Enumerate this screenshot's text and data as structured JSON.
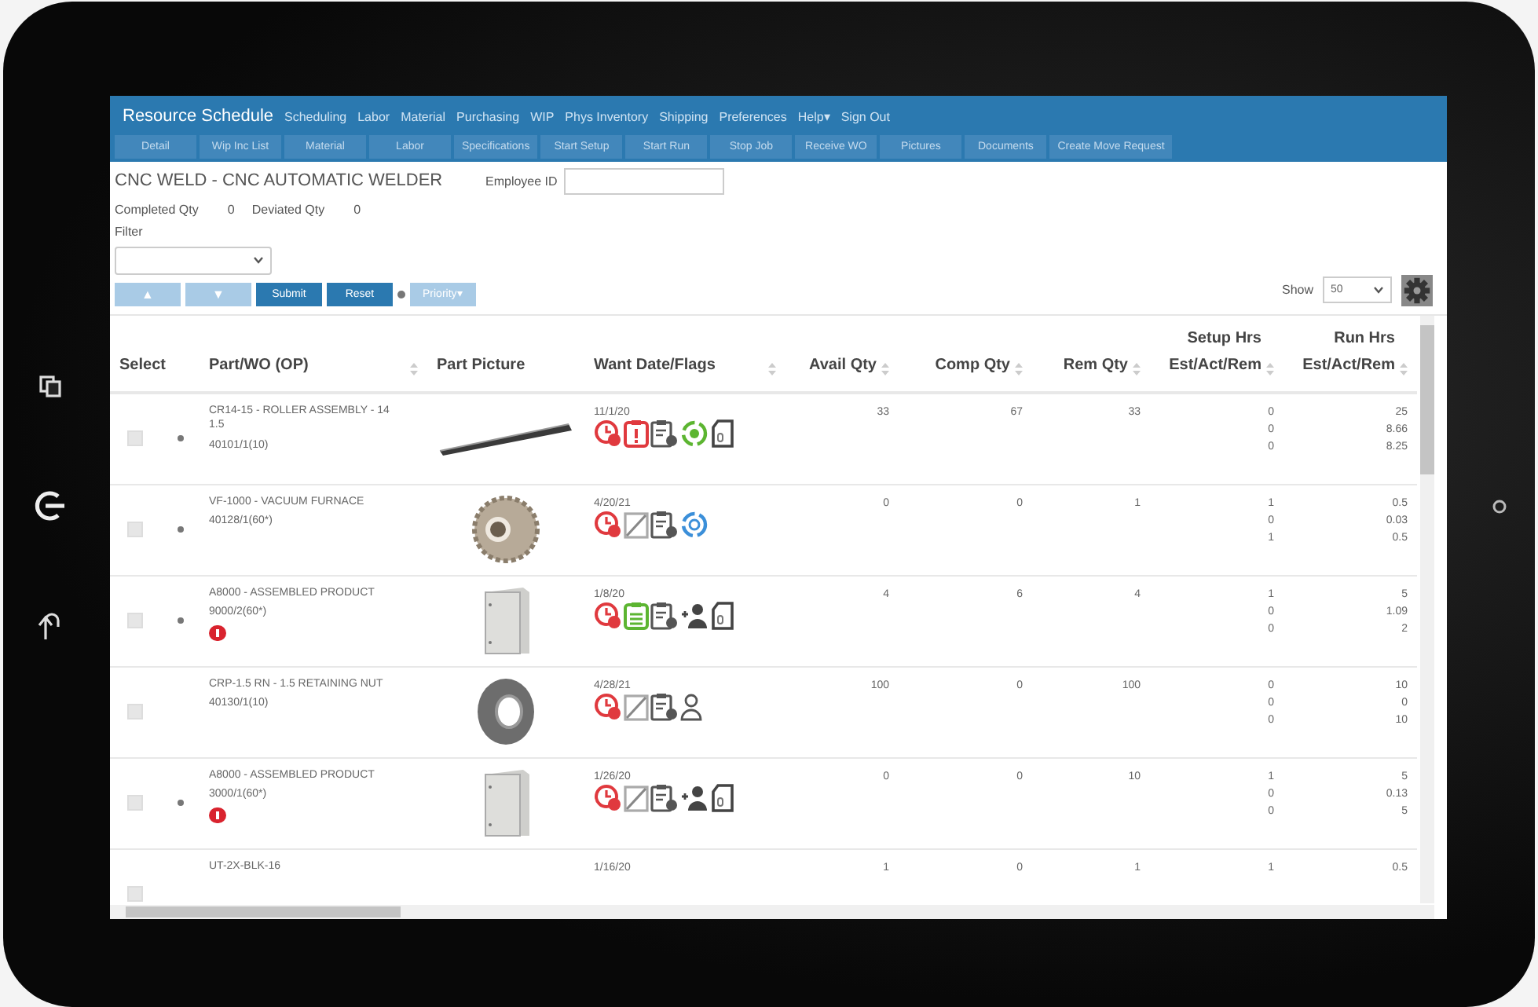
{
  "nav": {
    "brand": "Resource Schedule",
    "items": [
      {
        "label": "Scheduling"
      },
      {
        "label": "Labor"
      },
      {
        "label": "Material"
      },
      {
        "label": "Purchasing"
      },
      {
        "label": "WIP"
      },
      {
        "label": "Phys Inventory"
      },
      {
        "label": "Shipping"
      },
      {
        "label": "Preferences"
      },
      {
        "label": "Help",
        "caret": "▾"
      },
      {
        "label": "Sign Out"
      }
    ]
  },
  "toolbar": [
    {
      "label": "Detail",
      "disabled": true
    },
    {
      "label": "Wip Inc List",
      "disabled": true
    },
    {
      "label": "Material",
      "disabled": true
    },
    {
      "label": "Labor",
      "disabled": true
    },
    {
      "label": "Specifications",
      "disabled": true
    },
    {
      "label": "Start Setup",
      "disabled": true
    },
    {
      "label": "Start Run",
      "disabled": true
    },
    {
      "label": "Stop Job",
      "disabled": true
    },
    {
      "label": "Receive WO",
      "disabled": true
    },
    {
      "label": "Pictures",
      "disabled": true
    },
    {
      "label": "Documents",
      "disabled": true
    },
    {
      "label": "Create Move Request",
      "disabled": true
    }
  ],
  "header": {
    "title": "CNC WELD - CNC AUTOMATIC WELDER",
    "employee_label": "Employee ID",
    "completed_label": "Completed Qty",
    "completed_value": "0",
    "deviated_label": "Deviated Qty",
    "deviated_value": "0",
    "filter_label": "Filter"
  },
  "controls": {
    "up": "▲",
    "down": "▼",
    "submit": "Submit",
    "reset": "Reset",
    "priority": "Priority▾",
    "show_label": "Show",
    "show_value": "50"
  },
  "table": {
    "columns": [
      {
        "title": "Select",
        "sortable": false
      },
      {
        "title": "Part/WO (OP)",
        "sortable": true
      },
      {
        "title": "Part Picture",
        "sortable": false
      },
      {
        "title": "Want Date/Flags",
        "sortable": true
      },
      {
        "title": "Avail Qty",
        "sortable": true
      },
      {
        "title": "Comp Qty",
        "sortable": true
      },
      {
        "title": "Rem Qty",
        "sortable": true
      },
      {
        "title": "Setup Hrs",
        "sub": "Est/Act/Rem",
        "sortable": true
      },
      {
        "title": "Run Hrs",
        "sub": "Est/Act/Rem",
        "sortable": true
      }
    ],
    "rows": [
      {
        "checked": false,
        "bullet": true,
        "part": "CR14-15 - ROLLER ASSEMBLY - 14 1.5",
        "wo": "40101/1(10)",
        "alert": false,
        "picture": {
          "kind": "roller"
        },
        "date": "11/1/20",
        "flags": [
          {
            "kind": "clock"
          },
          {
            "kind": "alert-doc"
          },
          {
            "kind": "note"
          },
          {
            "kind": "cycle-green"
          },
          {
            "kind": "attach"
          }
        ],
        "avail": "33",
        "comp": "67",
        "rem": "33",
        "setup": [
          "0",
          "0",
          "0"
        ],
        "run": [
          "25",
          "8.66",
          "8.25"
        ]
      },
      {
        "checked": false,
        "bullet": true,
        "part": "VF-1000 - VACUUM FURNACE",
        "wo": "40128/1(60*)",
        "alert": false,
        "picture": {
          "kind": "gear"
        },
        "date": "4/20/21",
        "flags": [
          {
            "kind": "clock"
          },
          {
            "kind": "edit"
          },
          {
            "kind": "note"
          },
          {
            "kind": "cycle-blue"
          }
        ],
        "avail": "0",
        "comp": "0",
        "rem": "1",
        "setup": [
          "1",
          "0",
          "1"
        ],
        "run": [
          "0.5",
          "0.03",
          "0.5"
        ]
      },
      {
        "checked": false,
        "bullet": true,
        "part": "A8000 - ASSEMBLED PRODUCT",
        "wo": "9000/2(60*)",
        "alert": true,
        "picture": {
          "kind": "box"
        },
        "date": "1/8/20",
        "flags": [
          {
            "kind": "clock"
          },
          {
            "kind": "list-green"
          },
          {
            "kind": "note"
          },
          {
            "kind": "person-add"
          },
          {
            "kind": "attach"
          }
        ],
        "avail": "4",
        "comp": "6",
        "rem": "4",
        "setup": [
          "1",
          "0",
          "0"
        ],
        "run": [
          "5",
          "1.09",
          "2"
        ]
      },
      {
        "checked": false,
        "bullet": false,
        "part": "CRP-1.5 RN - 1.5 RETAINING NUT",
        "wo": "40130/1(10)",
        "alert": false,
        "picture": {
          "kind": "nut"
        },
        "date": "4/28/21",
        "flags": [
          {
            "kind": "clock"
          },
          {
            "kind": "edit"
          },
          {
            "kind": "note"
          },
          {
            "kind": "person"
          }
        ],
        "avail": "100",
        "comp": "0",
        "rem": "100",
        "setup": [
          "0",
          "0",
          "0"
        ],
        "run": [
          "10",
          "0",
          "10"
        ]
      },
      {
        "checked": false,
        "bullet": true,
        "part": "A8000 - ASSEMBLED PRODUCT",
        "wo": "3000/1(60*)",
        "alert": true,
        "picture": {
          "kind": "box"
        },
        "date": "1/26/20",
        "flags": [
          {
            "kind": "clock"
          },
          {
            "kind": "edit"
          },
          {
            "kind": "note"
          },
          {
            "kind": "person-add"
          },
          {
            "kind": "attach"
          }
        ],
        "avail": "0",
        "comp": "0",
        "rem": "10",
        "setup": [
          "1",
          "0",
          "0"
        ],
        "run": [
          "5",
          "0.13",
          "5"
        ]
      },
      {
        "checked": false,
        "bullet": false,
        "part": "UT-2X-BLK-16",
        "alert": false,
        "date": "1/16/20",
        "avail": "1",
        "comp": "0",
        "rem": "1",
        "setup": [
          "1"
        ],
        "run": [
          "0.5"
        ]
      }
    ]
  }
}
